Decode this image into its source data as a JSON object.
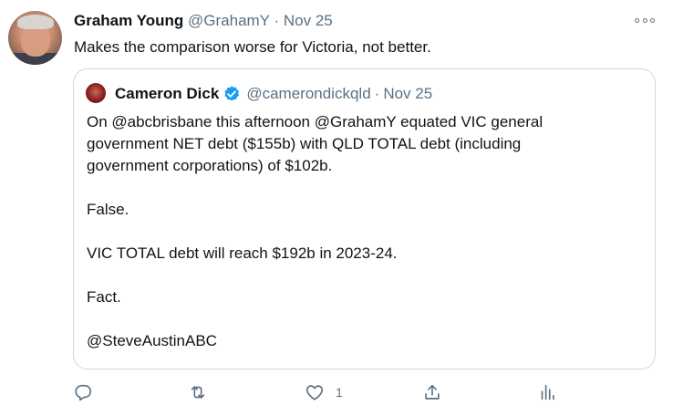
{
  "tweet": {
    "author_name": "Graham Young",
    "author_handle": "@GrahamY",
    "separator": "·",
    "date": "Nov 25",
    "text": "Makes the comparison worse for Victoria, not better."
  },
  "quoted": {
    "author_name": "Cameron Dick",
    "author_handle": "@camerondickqld",
    "separator": "·",
    "date": "Nov 25",
    "verified": true,
    "lines": [
      "On @abcbrisbane this afternoon @GrahamY equated VIC general",
      "government NET debt ($155b) with QLD TOTAL debt (including",
      "government corporations) of $102b.",
      "",
      "False.",
      "",
      "VIC TOTAL debt will reach $192b in 2023-24.",
      "",
      "Fact.",
      "",
      "@SteveAustinABC"
    ]
  },
  "actions": {
    "reply_icon": "reply-icon",
    "retweet_icon": "retweet-icon",
    "like_icon": "like-icon",
    "like_count": "1",
    "share_icon": "share-icon",
    "analytics_icon": "analytics-icon"
  },
  "colors": {
    "text": "#0f1419",
    "muted": "#5b7083",
    "verified": "#1d9bf0",
    "border": "#cfd9de"
  }
}
